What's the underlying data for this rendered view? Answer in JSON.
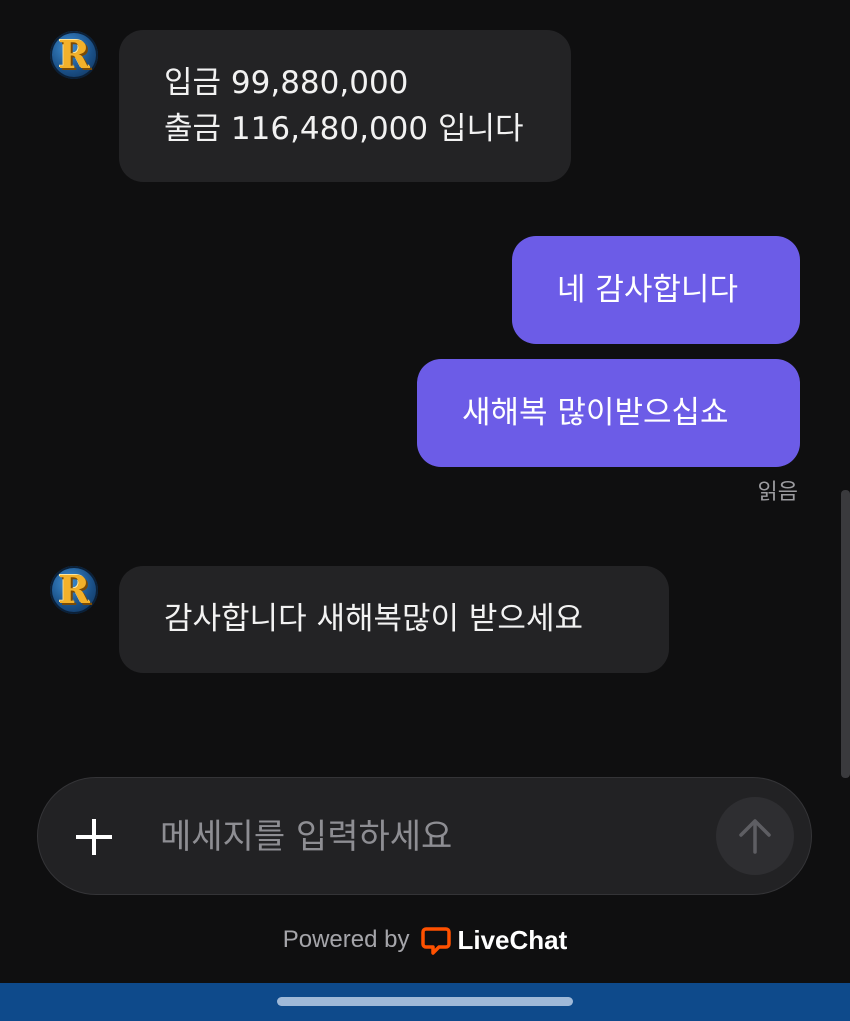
{
  "conversation": {
    "messages": [
      {
        "author": "agent",
        "lines": [
          "입금 99,880,000",
          "출금 116,480,000 입니다"
        ]
      },
      {
        "author": "visitor",
        "lines": [
          "네 감사합니다"
        ]
      },
      {
        "author": "visitor",
        "lines": [
          "새해복 많이받으십쇼"
        ]
      },
      {
        "author": "agent",
        "lines": [
          "감사합니다 새해복많이 받으세요"
        ]
      }
    ],
    "read_status": "읽음"
  },
  "agent": {
    "avatar_letter": "R",
    "avatar_icon": "gold-r-logo-icon"
  },
  "composer": {
    "placeholder": "메세지를 입력하세요",
    "value": "",
    "add_icon": "plus-icon",
    "send_icon": "arrow-up-icon"
  },
  "footer": {
    "powered_by": "Powered by",
    "brand_name": "LiveChat",
    "brand_icon": "livechat-logo-icon"
  },
  "colors": {
    "background": "#0f0f10",
    "agent_bubble": "#232325",
    "visitor_bubble": "#6c5ce7",
    "composer_bg": "#222224",
    "brand_orange": "#ff5100",
    "system_nav_bar": "#0e4a8b"
  }
}
